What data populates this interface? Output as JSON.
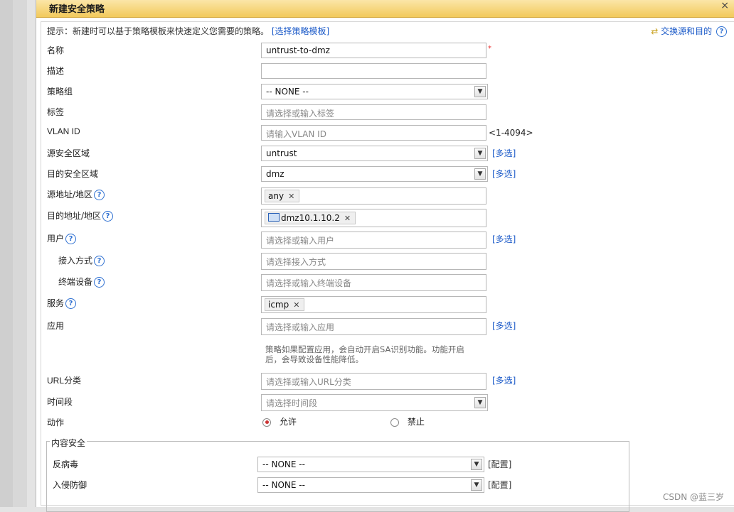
{
  "dialog": {
    "title": "新建安全策略",
    "close": "×"
  },
  "hint": {
    "text": "提示：新建时可以基于策略模板来快速定义您需要的策略。",
    "template_link": "[选择策略模板]"
  },
  "swap_link": "交换源和目的",
  "form": {
    "name_label": "名称",
    "name_value": "untrust-to-dmz",
    "desc_label": "描述",
    "group_label": "策略组",
    "group_value": "-- NONE --",
    "tag_label": "标签",
    "tag_placeholder": "请选择或输入标签",
    "vlan_label": "VLAN ID",
    "vlan_placeholder": "请输入VLAN ID",
    "vlan_range": "<1-4094>",
    "src_zone_label": "源安全区域",
    "src_zone_value": "untrust",
    "dst_zone_label": "目的安全区域",
    "dst_zone_value": "dmz",
    "multi": "[多选]",
    "src_addr_label": "源地址/地区",
    "src_addr_tag": "any",
    "dst_addr_label": "目的地址/地区",
    "dst_addr_tag": "dmz10.1.10.2",
    "user_label": "用户",
    "user_placeholder": "请选择或输入用户",
    "access_label": "接入方式",
    "access_placeholder": "请选择接入方式",
    "terminal_label": "终端设备",
    "terminal_placeholder": "请选择或输入终端设备",
    "service_label": "服务",
    "service_tag": "icmp",
    "app_label": "应用",
    "app_placeholder": "请选择或输入应用",
    "app_note_1": "策略如果配置应用，会自动开启SA识别功能。功能开启",
    "app_note_2": "后，会导致设备性能降低。",
    "url_label": "URL分类",
    "url_placeholder": "请选择或输入URL分类",
    "time_label": "时间段",
    "time_placeholder": "请选择时间段",
    "action_label": "动作",
    "action_allow": "允许",
    "action_deny": "禁止"
  },
  "content_security": {
    "legend": "内容安全",
    "antivirus_label": "反病毒",
    "antivirus_value": "-- NONE --",
    "ips_label": "入侵防御",
    "ips_value": "-- NONE --",
    "config": "[配置]"
  },
  "watermark": "CSDN @蓝三岁",
  "colors": {
    "accent": "#1a59c8",
    "title_bg": "#f2c95b",
    "required": "#e33333"
  }
}
